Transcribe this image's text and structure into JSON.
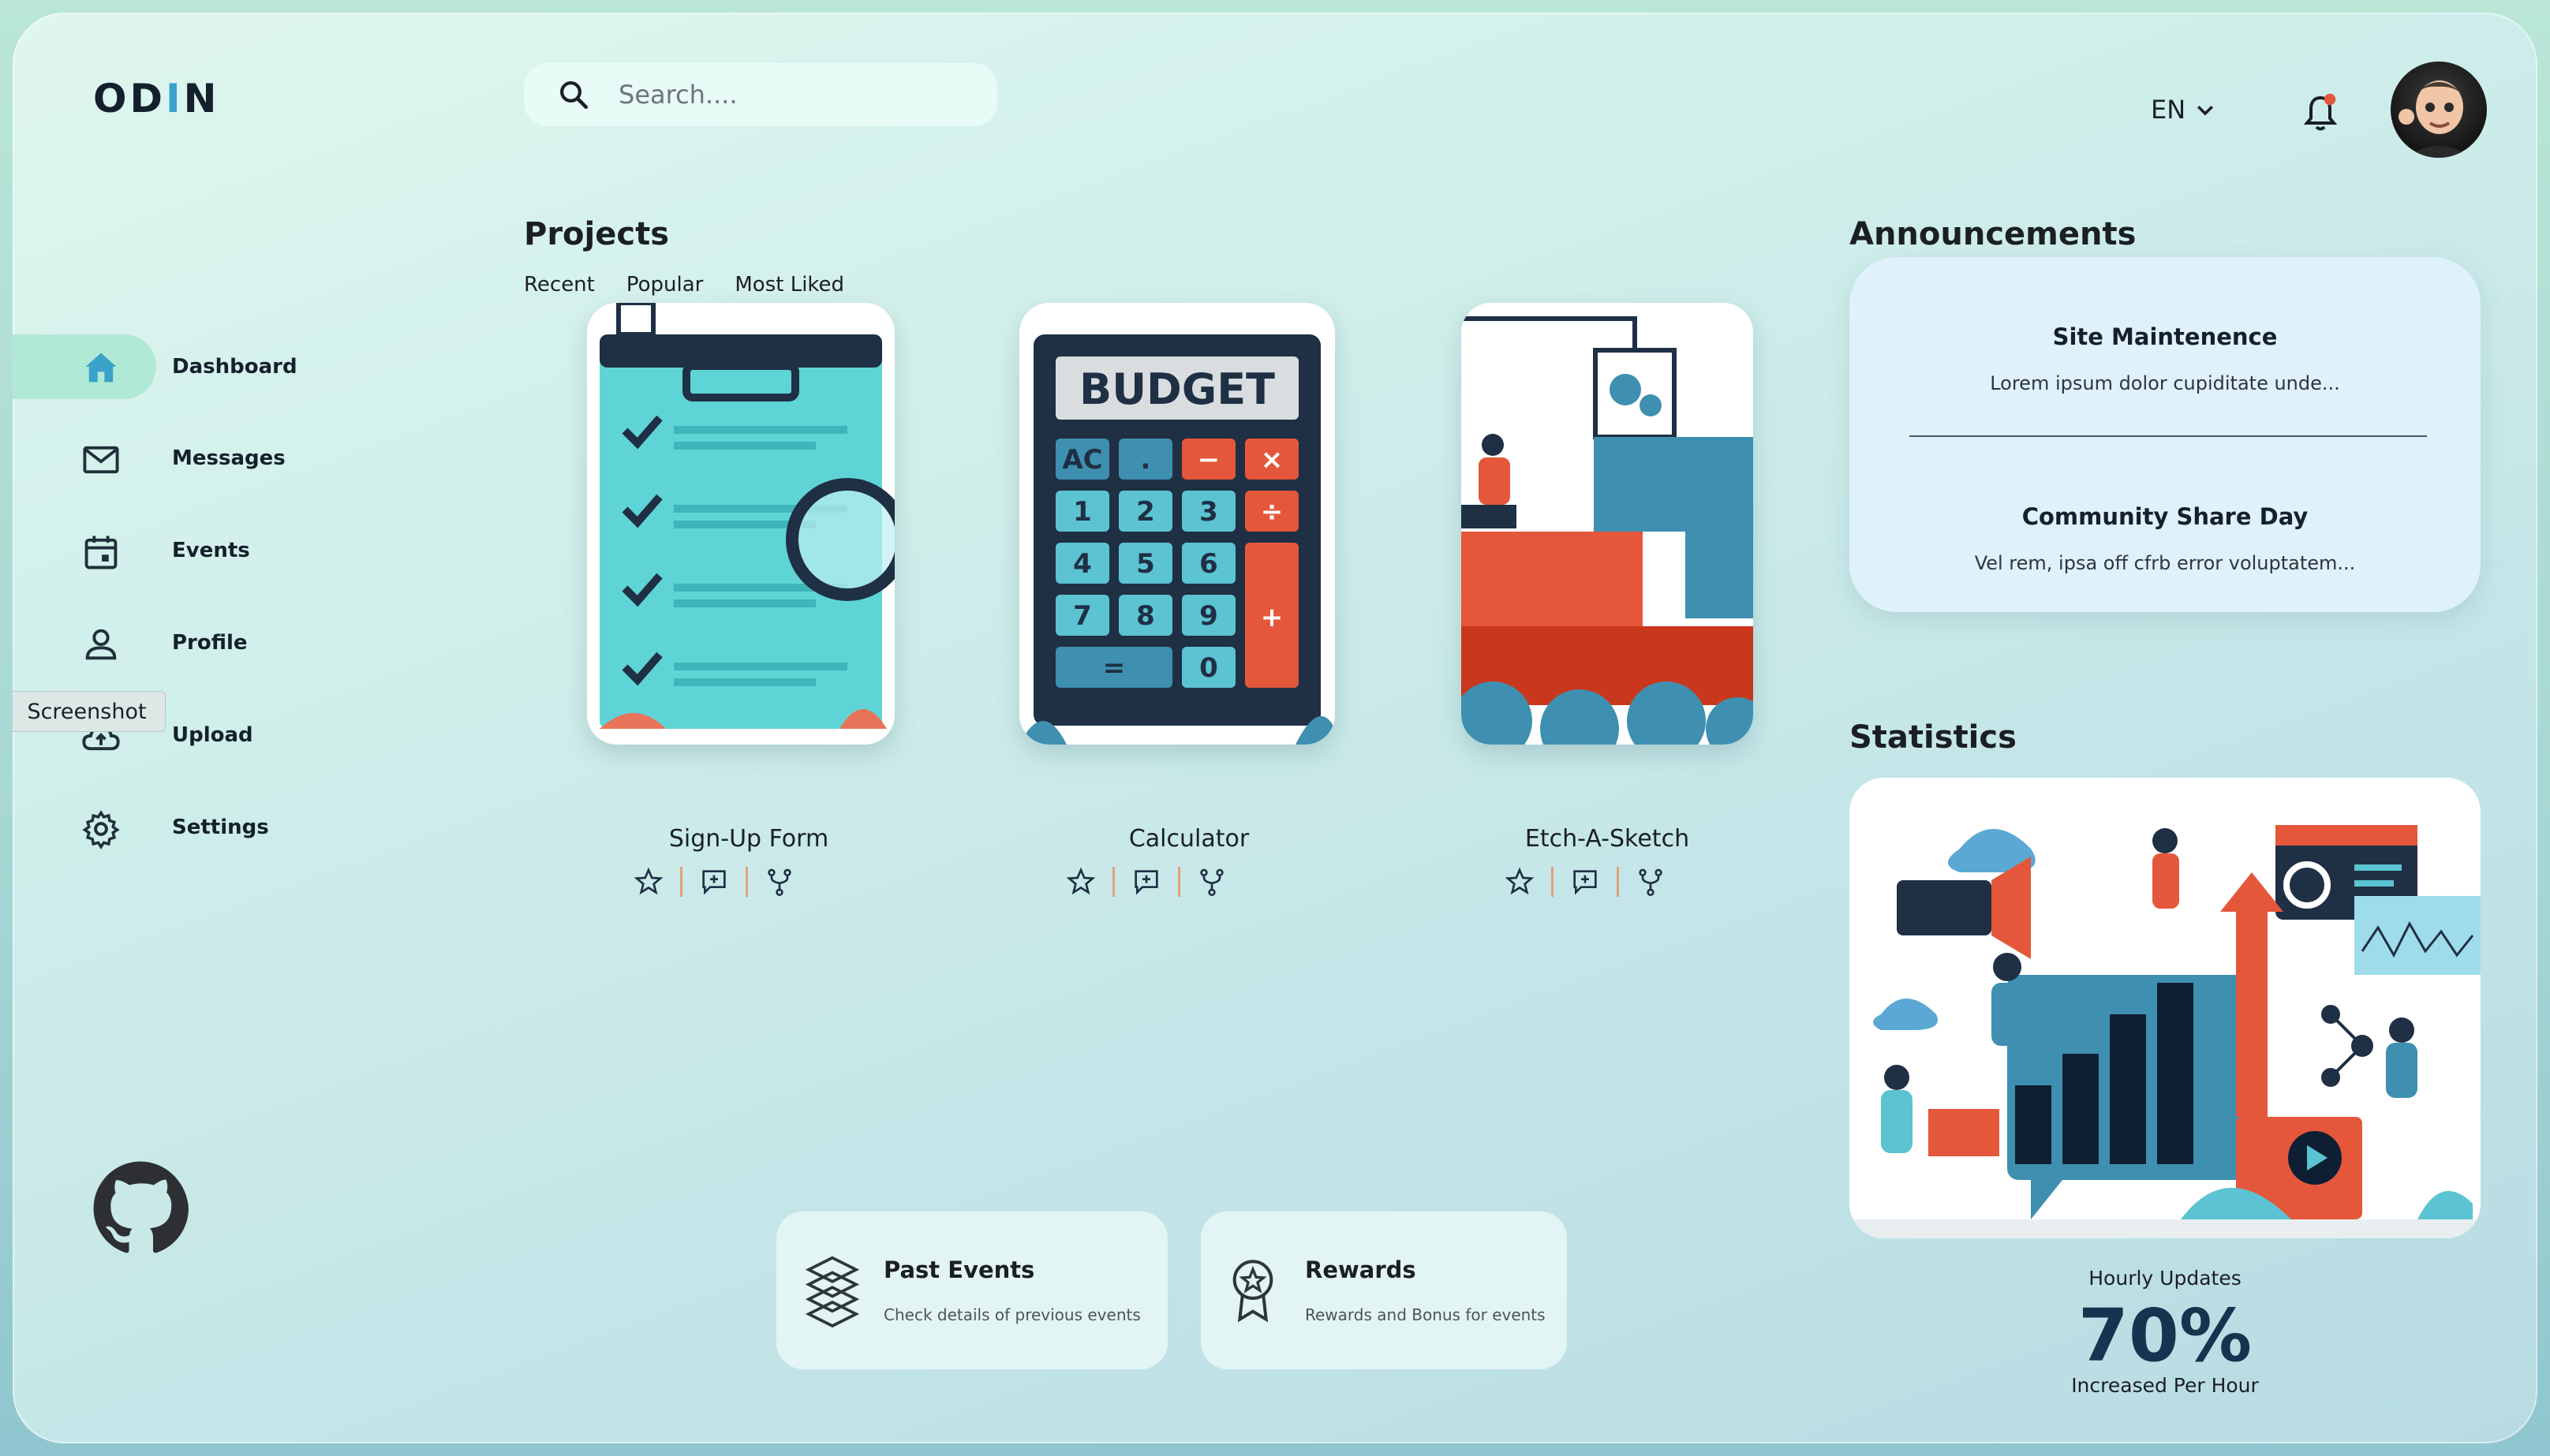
{
  "brand": {
    "logo_prefix": "OD",
    "logo_accent": "I",
    "logo_suffix": "N"
  },
  "search": {
    "placeholder": "Search...."
  },
  "header": {
    "language": "EN"
  },
  "sidebar": {
    "items": [
      {
        "label": "Dashboard",
        "active": true
      },
      {
        "label": "Messages"
      },
      {
        "label": "Events"
      },
      {
        "label": "Profile"
      },
      {
        "label": "Upload"
      },
      {
        "label": "Settings"
      }
    ],
    "tooltip": "Screenshot"
  },
  "projects": {
    "title": "Projects",
    "tabs": [
      "Recent",
      "Popular",
      "Most Liked"
    ],
    "items": [
      {
        "name": "Sign-Up Form"
      },
      {
        "name": "Calculator",
        "image_text": "BUDGET"
      },
      {
        "name": "Etch-A-Sketch"
      }
    ]
  },
  "bottom_cards": [
    {
      "title": "Past Events",
      "desc": "Check details of previous events"
    },
    {
      "title": "Rewards",
      "desc": "Rewards and Bonus for events"
    }
  ],
  "announcements": {
    "title": "Announcements",
    "items": [
      {
        "title": "Site Maintenence",
        "text": "Lorem ipsum dolor cupiditate unde..."
      },
      {
        "title": "Community Share Day",
        "text": "Vel rem, ipsa off cfrb error voluptatem..."
      }
    ]
  },
  "statistics": {
    "title": "Statistics",
    "caption": "Hourly Updates",
    "value": "70%",
    "subcaption": "Increased Per Hour"
  },
  "colors": {
    "accent": "#3aa1c9",
    "active_pill": "#b0ead6",
    "orange": "#e4573a",
    "navy": "#16344f"
  }
}
